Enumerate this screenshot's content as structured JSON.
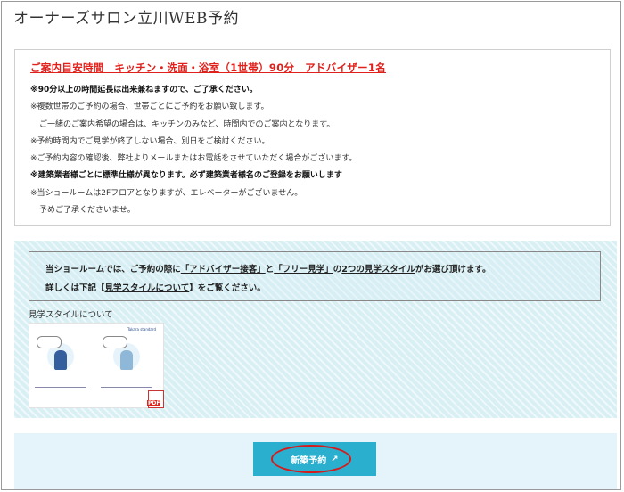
{
  "page": {
    "title": "オーナーズサロン立川WEB予約"
  },
  "notice": {
    "heading": "ご案内目安時間　キッチン・洗面・浴室（1世帯）90分　アドバイザー1名",
    "lines": [
      "※90分以上の時間延長は出来兼ねますので、ご了承ください。",
      "※複数世帯のご予約の場合、世帯ごとにご予約をお願い致します。",
      "ご一緒のご案内希望の場合は、キッチンのみなど、時間内でのご案内となります。",
      "※予約時間内でご見学が終了しない場合、別日をご検討ください。",
      "※ご予約内容の確認後、弊社よりメールまたはお電話をさせていただく場合がございます。",
      "※建築業者様ごとに標準仕様が異なります。必ず建築業者様名のご登録をお願いします",
      "※当ショールームは2Fフロアとなりますが、エレベーターがございません。",
      "予めご了承くださいませ。"
    ]
  },
  "style_info": {
    "line1_a": "当ショールームでは、ご予約の際に",
    "line1_b": "「アドバイザー接客」",
    "line1_c": "と",
    "line1_d": "「フリー見学」",
    "line1_e": "の",
    "line1_f": "2つの見学スタイル",
    "line1_g": "がお選び頂けます。",
    "line2_a": "詳しくは下記【",
    "line2_b": "見学スタイルについて",
    "line2_c": "】をご覧ください。",
    "link_title": "見学スタイルについて",
    "pdf_label": "PDF"
  },
  "booking": {
    "button_label": "新築予約",
    "button_icon": "external-link-icon",
    "highlight_color": "#d41c1c",
    "button_color": "#2aafcf"
  }
}
